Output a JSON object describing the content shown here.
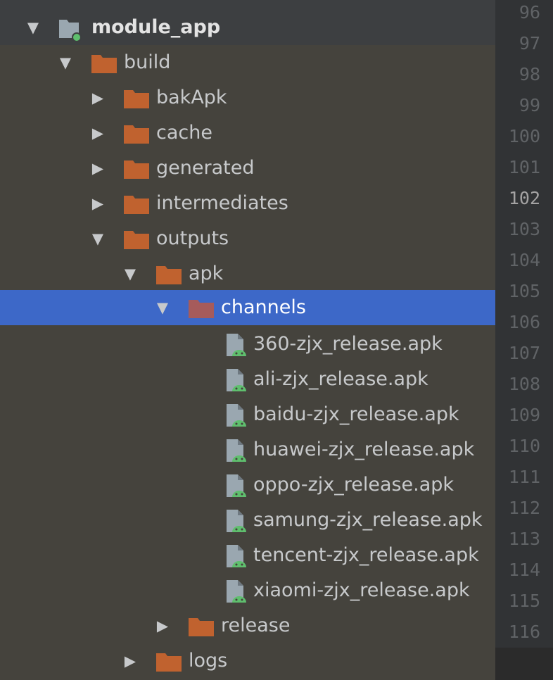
{
  "tree": {
    "rows": [
      {
        "label": "module_app",
        "expanded": true,
        "icon": "module-icon"
      },
      {
        "label": "build",
        "expanded": true,
        "icon": "folder-icon"
      },
      {
        "label": "bakApk",
        "expanded": false,
        "icon": "folder-icon"
      },
      {
        "label": "cache",
        "expanded": false,
        "icon": "folder-icon"
      },
      {
        "label": "generated",
        "expanded": false,
        "icon": "folder-icon"
      },
      {
        "label": "intermediates",
        "expanded": false,
        "icon": "folder-icon"
      },
      {
        "label": "outputs",
        "expanded": true,
        "icon": "folder-icon"
      },
      {
        "label": "apk",
        "expanded": true,
        "icon": "folder-icon"
      },
      {
        "label": "channels",
        "expanded": true,
        "icon": "folder-icon",
        "selected": true
      },
      {
        "label": "360-zjx_release.apk",
        "icon": "android-apk-icon"
      },
      {
        "label": "ali-zjx_release.apk",
        "icon": "android-apk-icon"
      },
      {
        "label": "baidu-zjx_release.apk",
        "icon": "android-apk-icon"
      },
      {
        "label": "huawei-zjx_release.apk",
        "icon": "android-apk-icon"
      },
      {
        "label": "oppo-zjx_release.apk",
        "icon": "android-apk-icon"
      },
      {
        "label": "samung-zjx_release.apk",
        "icon": "android-apk-icon"
      },
      {
        "label": "tencent-zjx_release.apk",
        "icon": "android-apk-icon"
      },
      {
        "label": "xiaomi-zjx_release.apk",
        "icon": "android-apk-icon"
      },
      {
        "label": "release",
        "expanded": false,
        "icon": "folder-icon"
      },
      {
        "label": "logs",
        "expanded": false,
        "icon": "folder-icon"
      }
    ]
  },
  "gutter": {
    "lines": [
      "96",
      "97",
      "98",
      "99",
      "100",
      "101",
      "102",
      "103",
      "104",
      "105",
      "106",
      "107",
      "108",
      "109",
      "110",
      "111",
      "112",
      "113",
      "114",
      "115",
      "116"
    ],
    "current_line": "102"
  },
  "colors": {
    "tree_background": "#45433d",
    "selection": "#3d68c8",
    "folder": "#c0622f",
    "selected_folder": "#a65b5b",
    "android_green": "#5fbf6e",
    "gutter_background": "#313335"
  }
}
